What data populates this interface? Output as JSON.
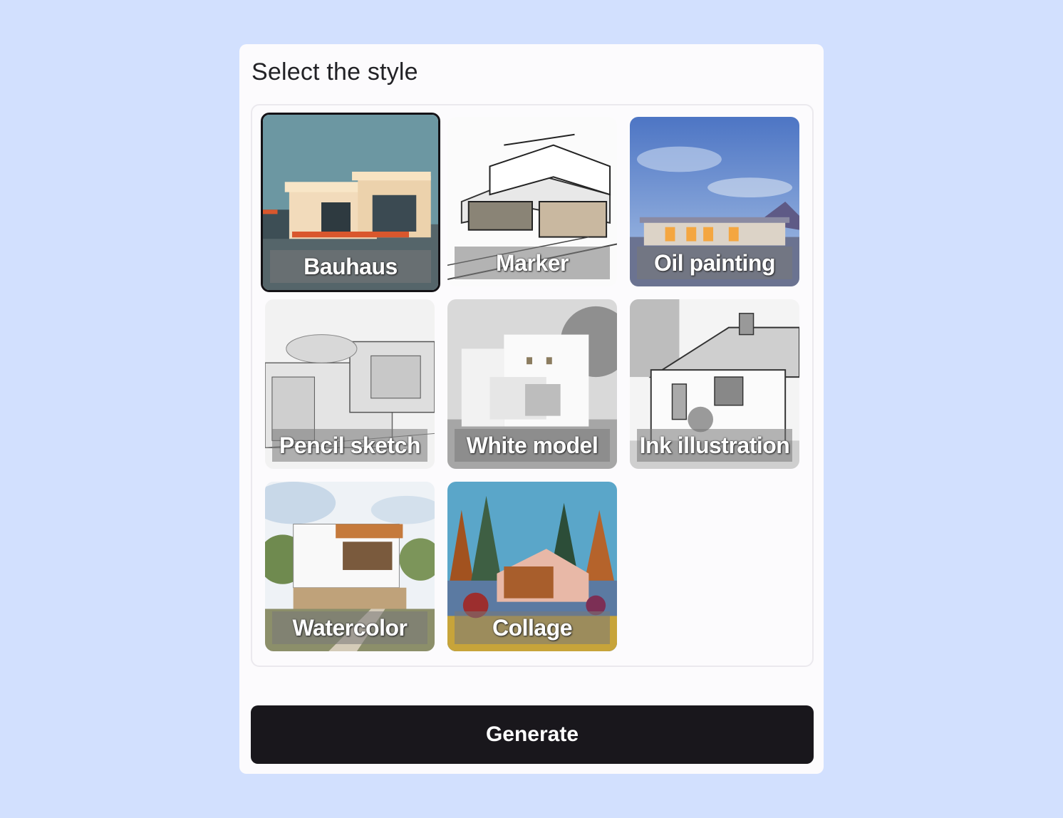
{
  "panel": {
    "title": "Select the style"
  },
  "styles": [
    {
      "label": "Bauhaus",
      "selected": true,
      "icon": "bauhaus-house-thumbnail"
    },
    {
      "label": "Marker",
      "selected": false,
      "icon": "marker-sketch-thumbnail"
    },
    {
      "label": "Oil painting",
      "selected": false,
      "icon": "oil-painting-thumbnail"
    },
    {
      "label": "Pencil sketch",
      "selected": false,
      "icon": "pencil-sketch-thumbnail"
    },
    {
      "label": "White model",
      "selected": false,
      "icon": "white-model-thumbnail"
    },
    {
      "label": "Ink illustration",
      "selected": false,
      "icon": "ink-illustration-thumbnail"
    },
    {
      "label": "Watercolor",
      "selected": false,
      "icon": "watercolor-thumbnail"
    },
    {
      "label": "Collage",
      "selected": false,
      "icon": "collage-thumbnail"
    }
  ],
  "actions": {
    "generate_label": "Generate"
  },
  "colors": {
    "background": "#d2e0fe",
    "panel": "#fcfbfd",
    "button": "#19171c",
    "selected_border": "#141216"
  }
}
